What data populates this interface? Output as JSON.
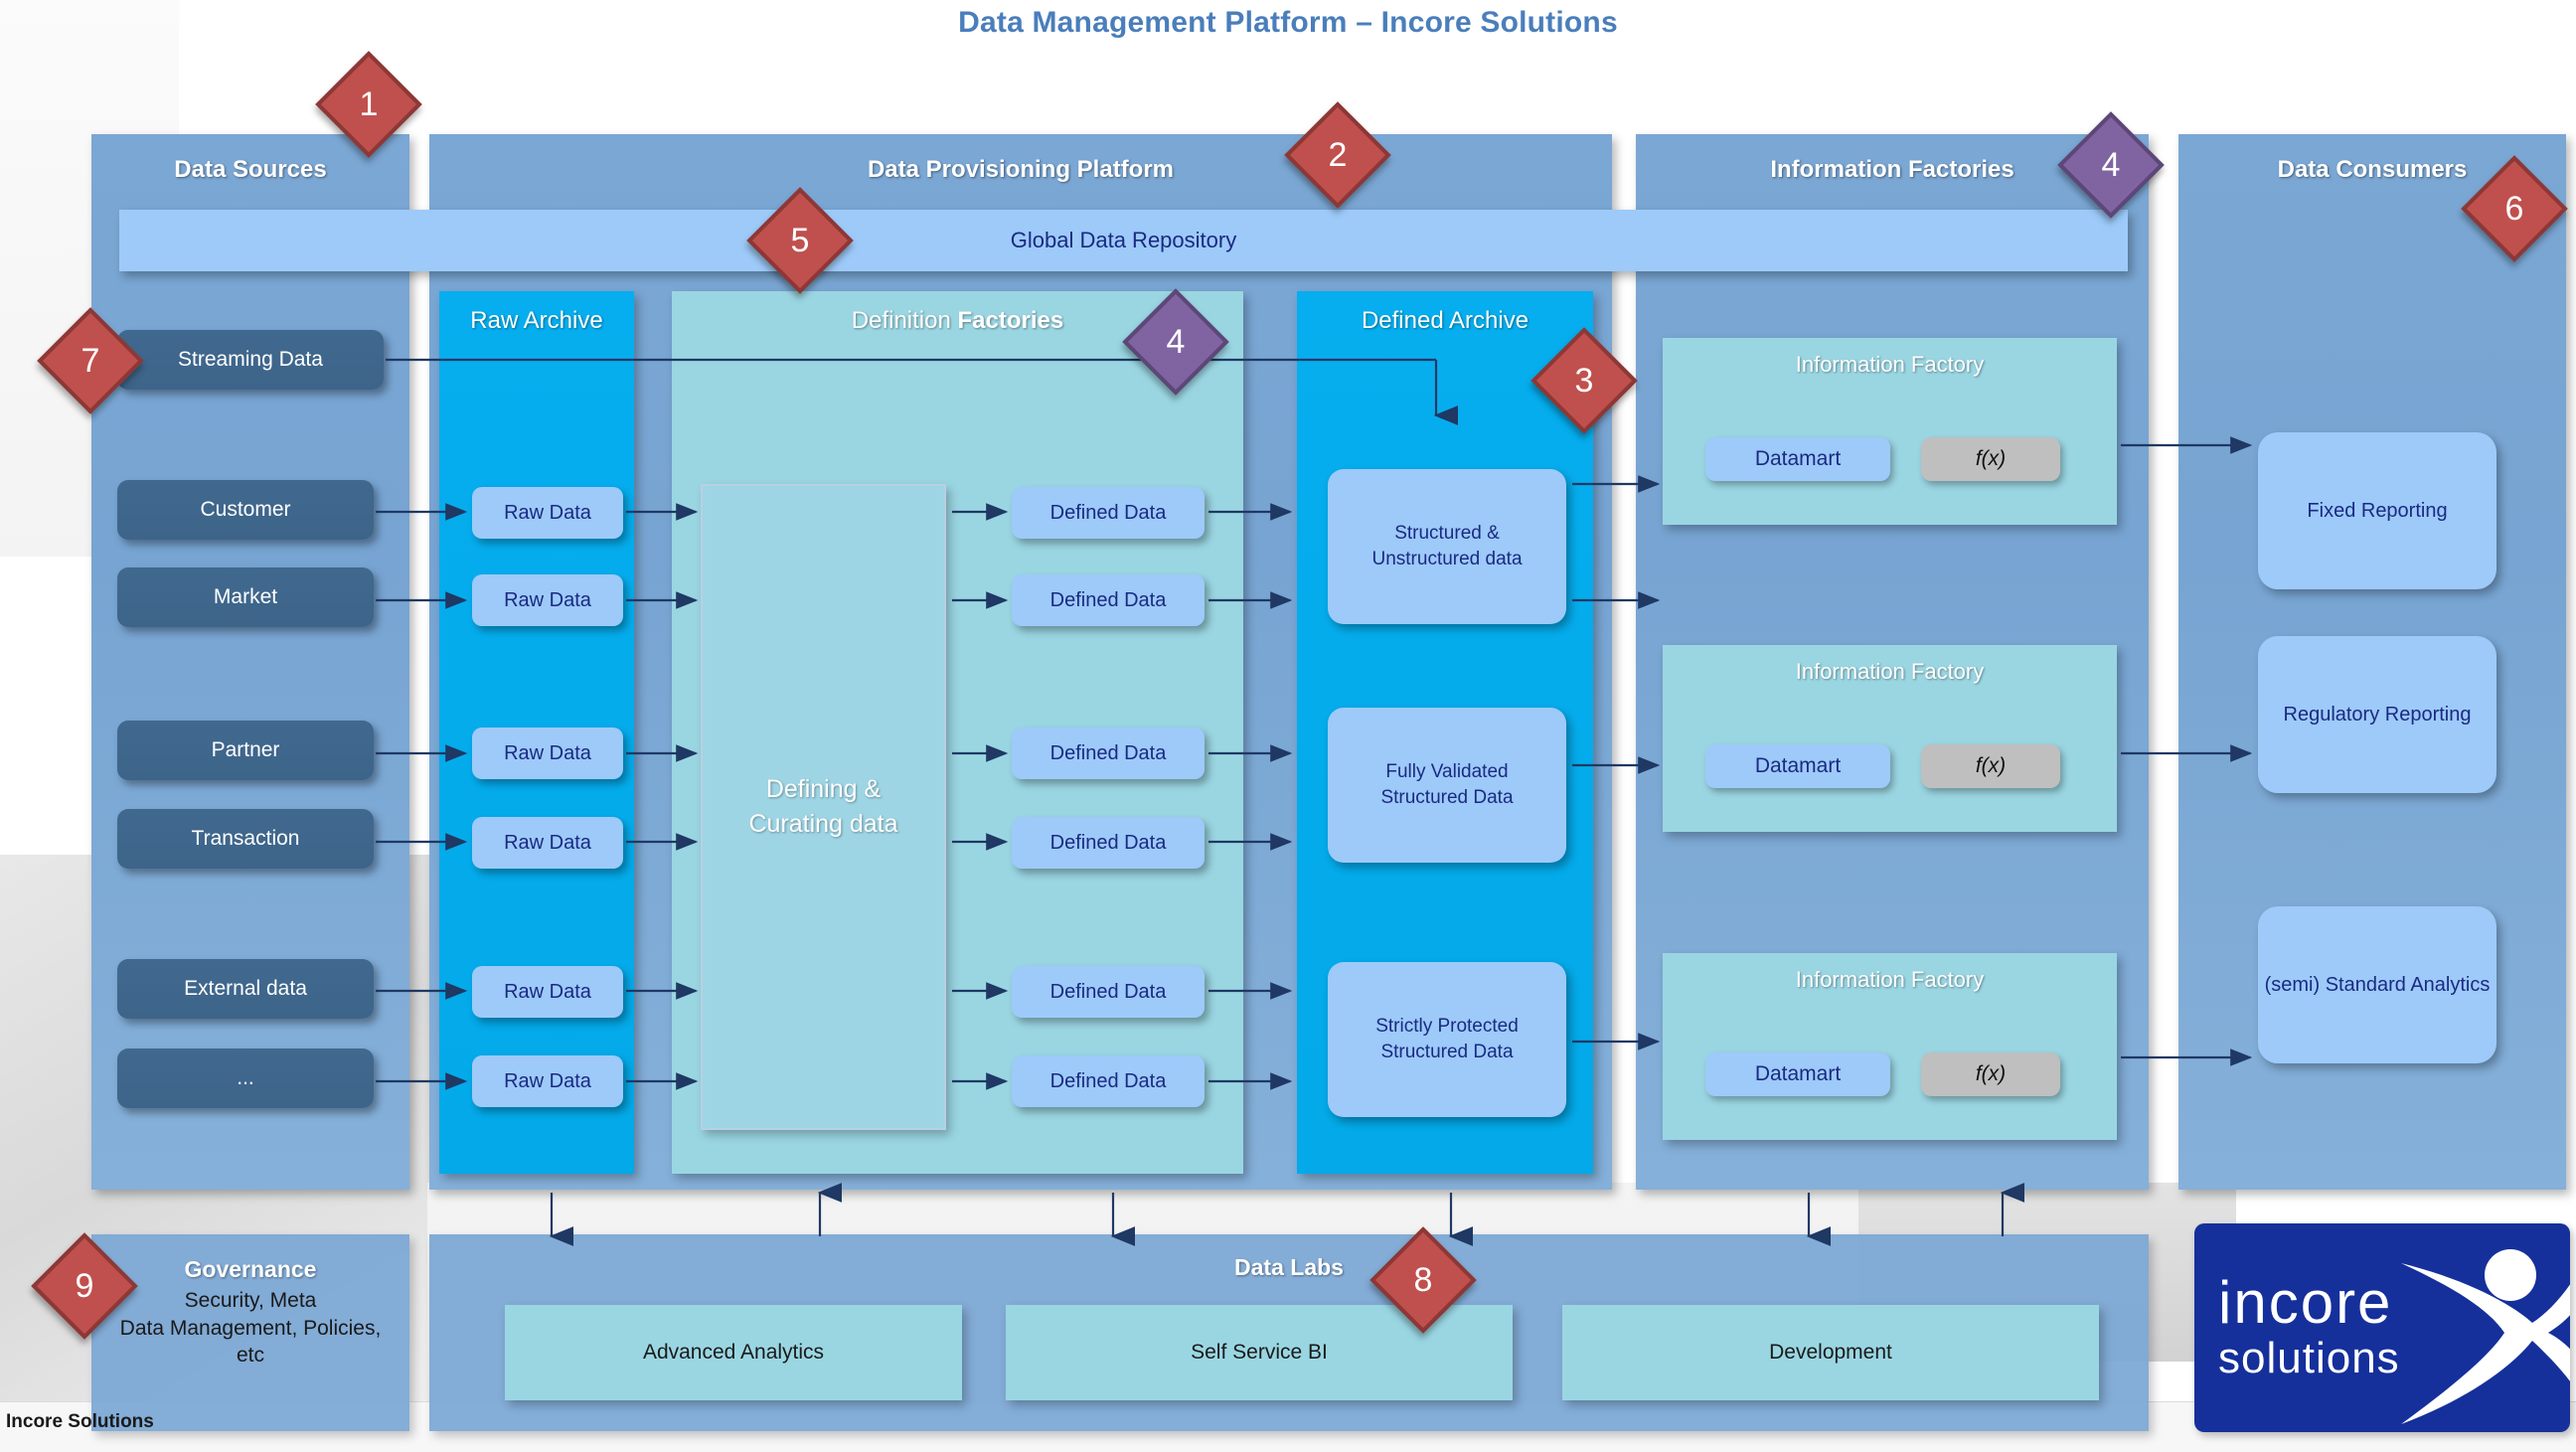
{
  "title": "Data Management Platform – Incore Solutions",
  "footer": "Incore Solutions",
  "colors": {
    "title": "#4a7ebb",
    "column": "#7ba7d4",
    "archive_cyan": "#06aeef",
    "factory_teal": "#9ad6e2",
    "databox_blue": "#9dcaf9",
    "source_pill": "#41698f",
    "diamond_red": "#c0504d",
    "diamond_purple": "#8064a2",
    "logo_blue": "#15309b",
    "fx_grey": "#bfbfbf"
  },
  "columns": {
    "data_sources": {
      "title": "Data Sources"
    },
    "provisioning": {
      "title": "Data Provisioning Platform"
    },
    "info_factories": {
      "title": "Information Factories"
    },
    "data_consumers": {
      "title": "Data Consumers"
    }
  },
  "global_repository": {
    "label": "Global Data Repository"
  },
  "sources": [
    {
      "label": "Streaming Data"
    },
    {
      "label": "Customer"
    },
    {
      "label": "Market"
    },
    {
      "label": "Partner"
    },
    {
      "label": "Transaction"
    },
    {
      "label": "External data"
    },
    {
      "label": "..."
    }
  ],
  "raw_archive": {
    "title": "Raw Archive",
    "items": [
      {
        "label": "Raw Data"
      },
      {
        "label": "Raw Data"
      },
      {
        "label": "Raw Data"
      },
      {
        "label": "Raw Data"
      },
      {
        "label": "Raw Data"
      },
      {
        "label": "Raw Data"
      }
    ]
  },
  "definition_factories": {
    "title_normal": "Definition ",
    "title_bold": "Factories",
    "center_box": "Defining &\nCurating data",
    "items": [
      {
        "label": "Defined Data"
      },
      {
        "label": "Defined Data"
      },
      {
        "label": "Defined Data"
      },
      {
        "label": "Defined Data"
      },
      {
        "label": "Defined Data"
      },
      {
        "label": "Defined Data"
      }
    ]
  },
  "defined_archive": {
    "title": "Defined Archive",
    "items": [
      {
        "label": "Structured &\nUnstructured data"
      },
      {
        "label": "Fully Validated\nStructured Data"
      },
      {
        "label": "Strictly Protected\nStructured Data"
      }
    ]
  },
  "information_factories": [
    {
      "title": "Information Factory",
      "datamart": "Datamart",
      "function": "f(x)"
    },
    {
      "title": "Information Factory",
      "datamart": "Datamart",
      "function": "f(x)"
    },
    {
      "title": "Information Factory",
      "datamart": "Datamart",
      "function": "f(x)"
    }
  ],
  "consumers": [
    {
      "label": "Fixed Reporting"
    },
    {
      "label": "Regulatory Reporting"
    },
    {
      "label": "(semi) Standard Analytics"
    }
  ],
  "governance": {
    "title": "Governance",
    "line1": "Security, Meta",
    "line2": "Data Management, Policies,",
    "line3": "etc"
  },
  "data_labs": {
    "title": "Data Labs",
    "items": [
      {
        "label": "Advanced Analytics"
      },
      {
        "label": "Self Service BI"
      },
      {
        "label": "Development"
      }
    ]
  },
  "markers": [
    {
      "id": "1",
      "value": "1",
      "color": "red"
    },
    {
      "id": "2",
      "value": "2",
      "color": "red"
    },
    {
      "id": "3",
      "value": "3",
      "color": "red"
    },
    {
      "id": "4a",
      "value": "4",
      "color": "purple"
    },
    {
      "id": "4b",
      "value": "4",
      "color": "purple"
    },
    {
      "id": "5",
      "value": "5",
      "color": "red"
    },
    {
      "id": "6",
      "value": "6",
      "color": "red"
    },
    {
      "id": "7",
      "value": "7",
      "color": "red"
    },
    {
      "id": "8",
      "value": "8",
      "color": "red"
    },
    {
      "id": "9",
      "value": "9",
      "color": "red"
    }
  ],
  "logo": {
    "line1": "incore",
    "line2": "solutions"
  }
}
